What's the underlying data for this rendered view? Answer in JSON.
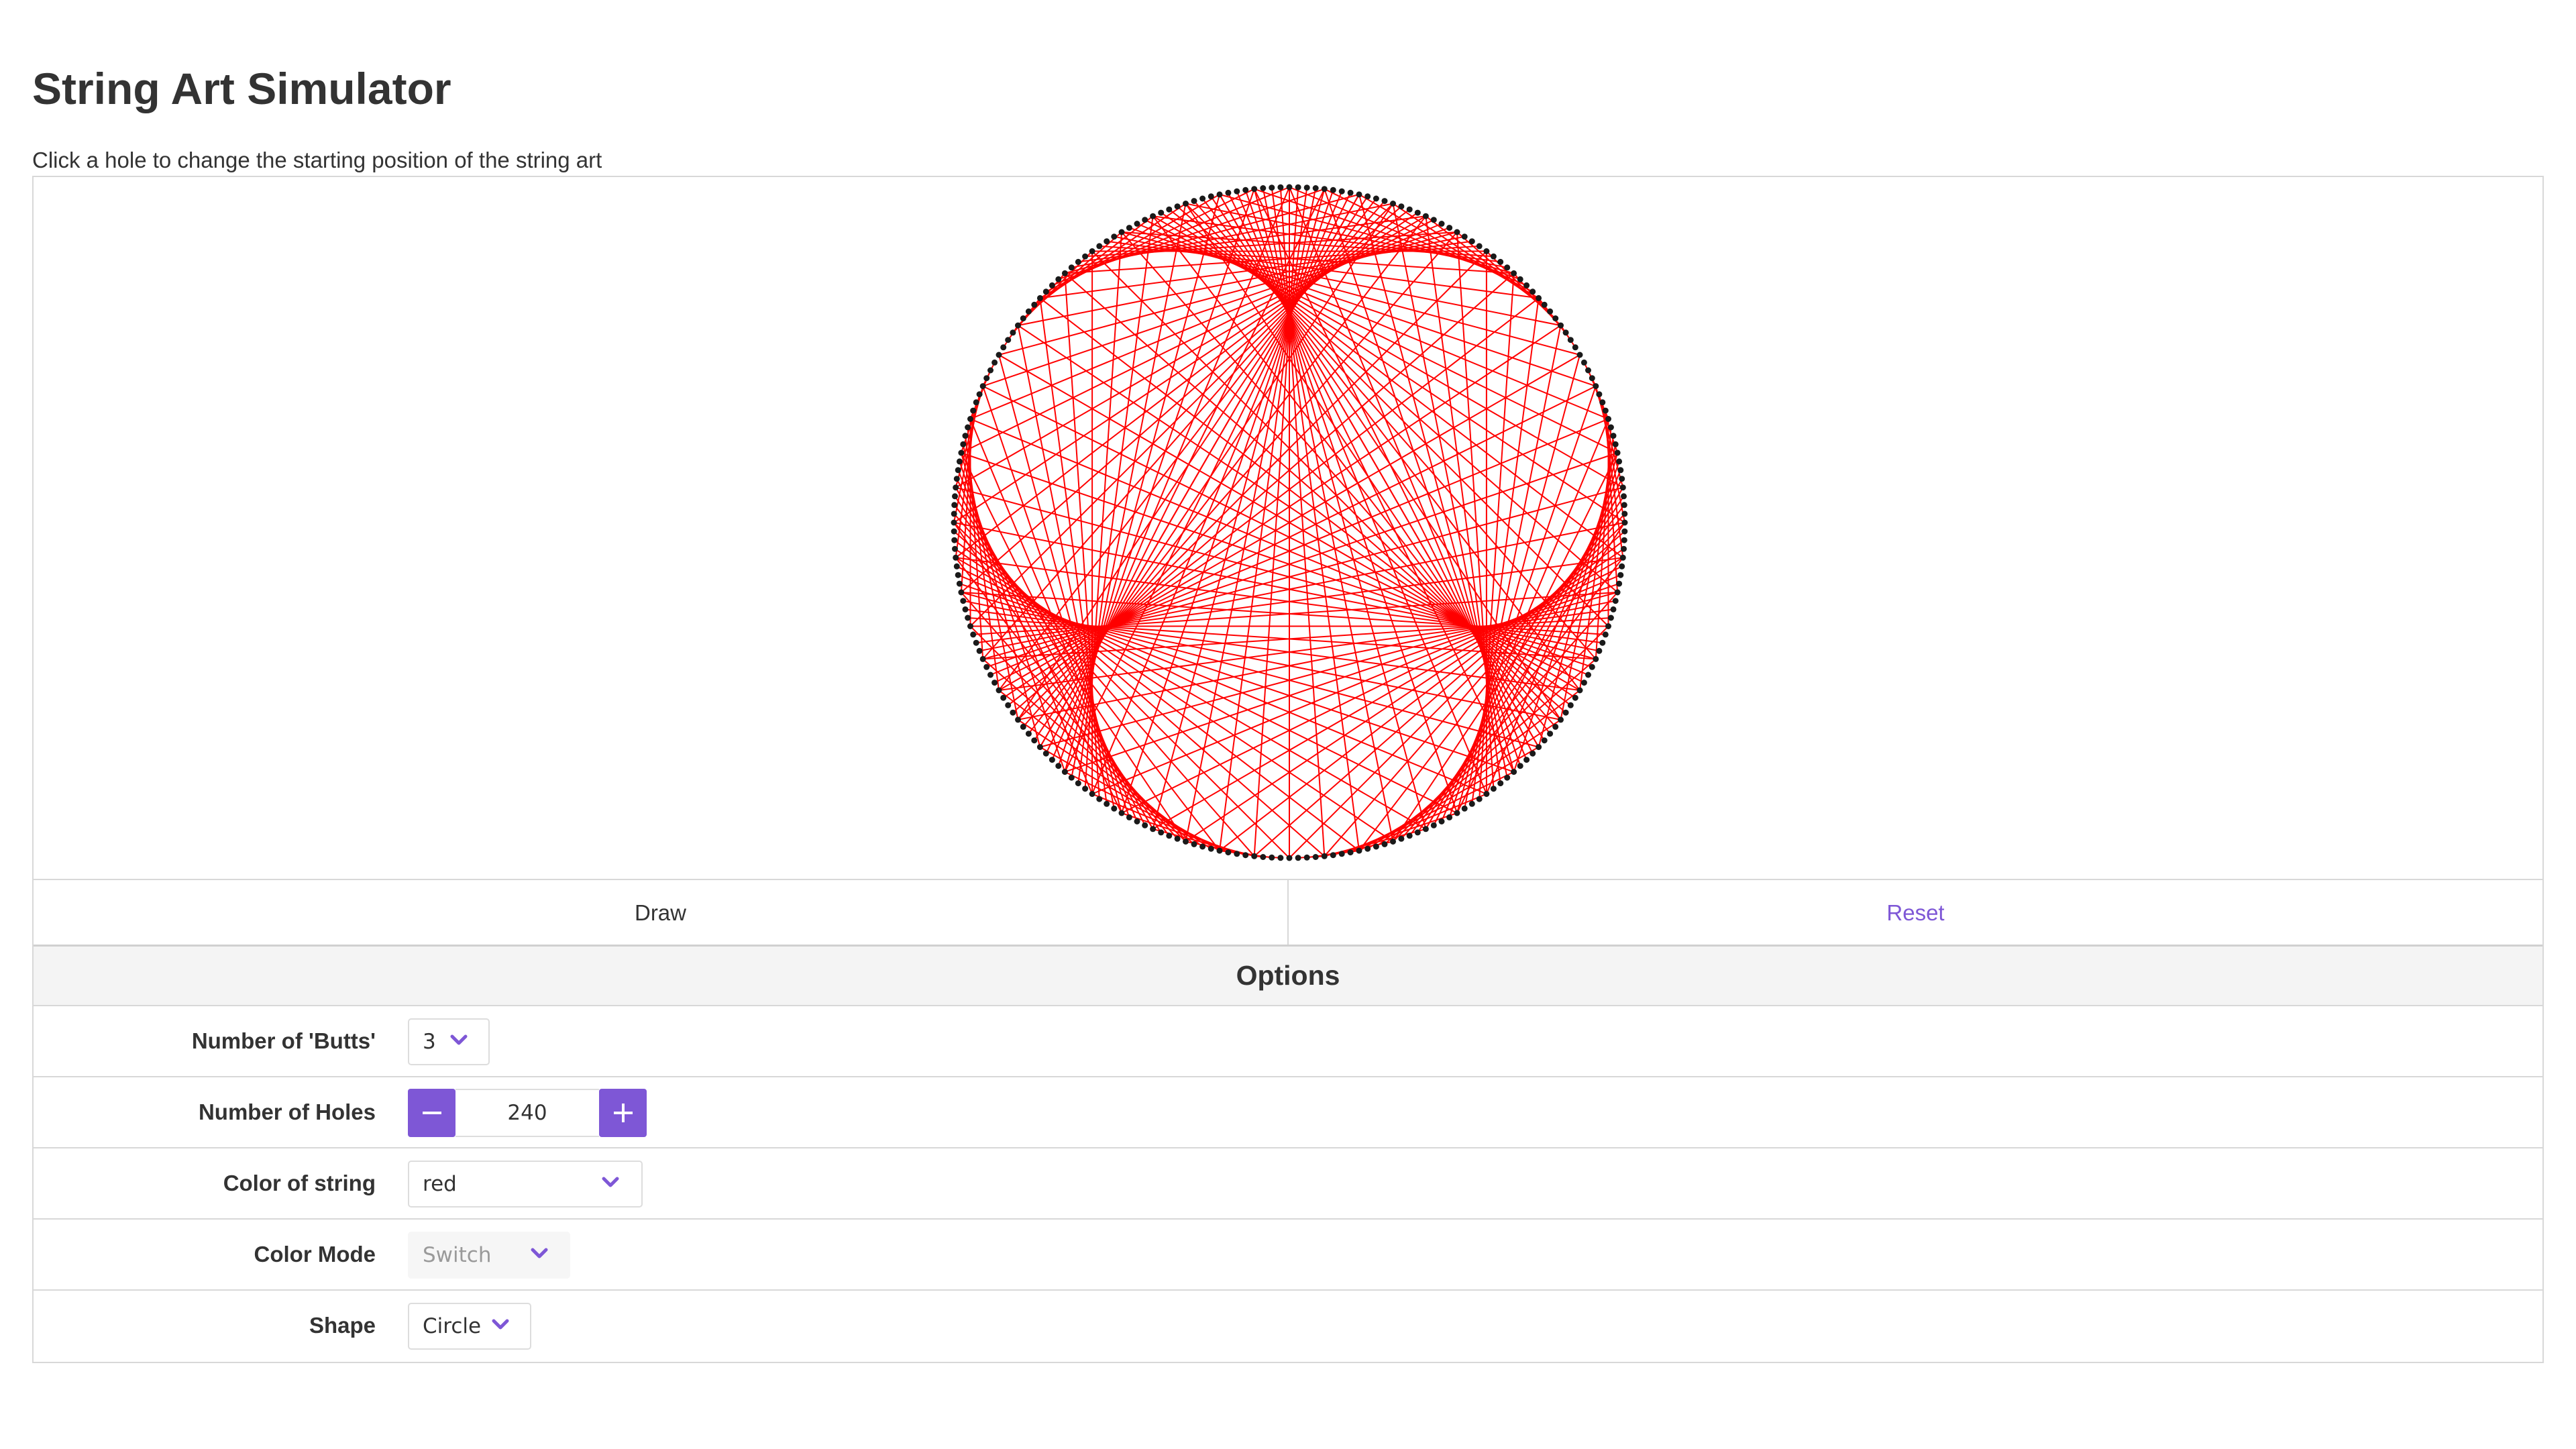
{
  "page": {
    "title": "String Art Simulator",
    "instruction": "Click a hole to change the starting position of the string art"
  },
  "actions": {
    "draw_label": "Draw",
    "reset_label": "Reset"
  },
  "options": {
    "header": "Options",
    "butts": {
      "label": "Number of 'Butts'",
      "value": "3"
    },
    "holes": {
      "label": "Number of Holes",
      "value": "240",
      "decrement_icon": "minus-icon",
      "increment_icon": "plus-icon"
    },
    "string_color": {
      "label": "Color of string",
      "value": "red"
    },
    "color_mode": {
      "label": "Color Mode",
      "value": "Switch",
      "disabled": true
    },
    "shape": {
      "label": "Shape",
      "value": "Circle"
    }
  },
  "art": {
    "holes": 240,
    "butts": 3,
    "shape": "circle",
    "string_color": "#ff0000",
    "hole_color": "#1a1a1a"
  },
  "colors": {
    "accent": "#7e57d6",
    "border": "#d8d8d8",
    "header_bg": "#f4f4f4"
  }
}
